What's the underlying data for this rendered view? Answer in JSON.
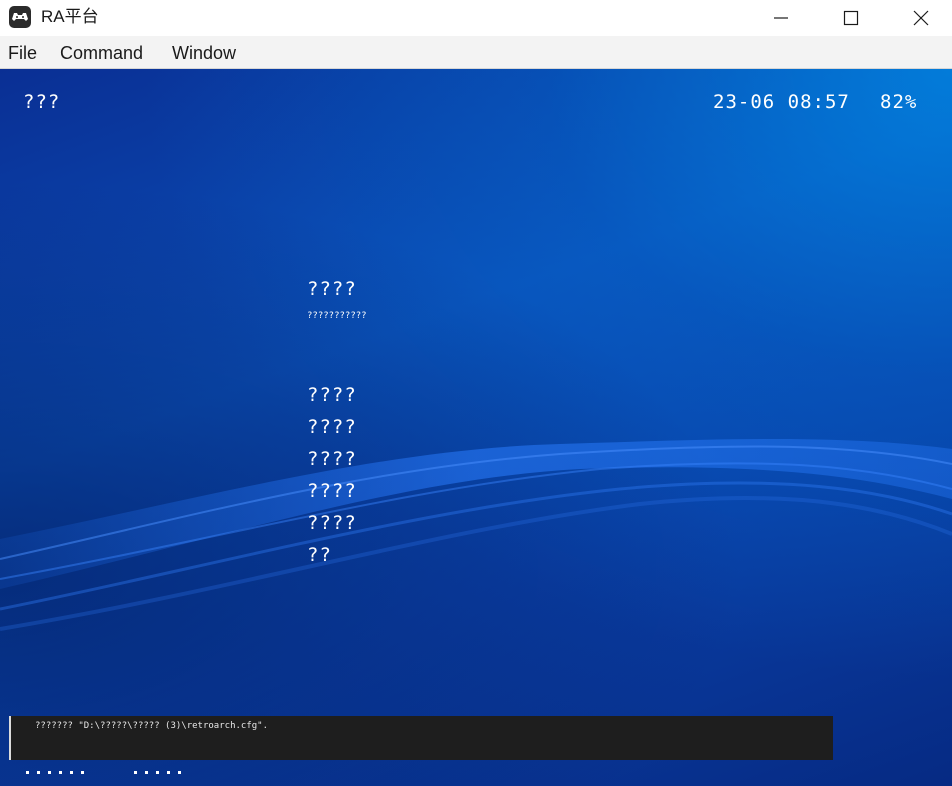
{
  "window": {
    "title": "RA平台"
  },
  "menubar": {
    "items": [
      {
        "label": "File"
      },
      {
        "label": "Command"
      },
      {
        "label": "Window"
      }
    ]
  },
  "hud": {
    "title": "???",
    "clock": "23-06 08:57",
    "battery": "82%"
  },
  "main_menu": {
    "heading": "????",
    "subtitle": "???????????",
    "entries": [
      {
        "label": "????"
      },
      {
        "label": "????"
      },
      {
        "label": "????"
      },
      {
        "label": "????"
      },
      {
        "label": "????"
      },
      {
        "label": "??"
      }
    ]
  },
  "notification": {
    "text": "??????? \"D:\\?????\\????? (3)\\retroarch.cfg\"."
  },
  "colors": {
    "background_top": "#0b4fb8",
    "background_bottom": "#062a83",
    "wave": "#1a6cf0",
    "notification_bg": "#1e1e1e",
    "text": "#ffffff"
  }
}
